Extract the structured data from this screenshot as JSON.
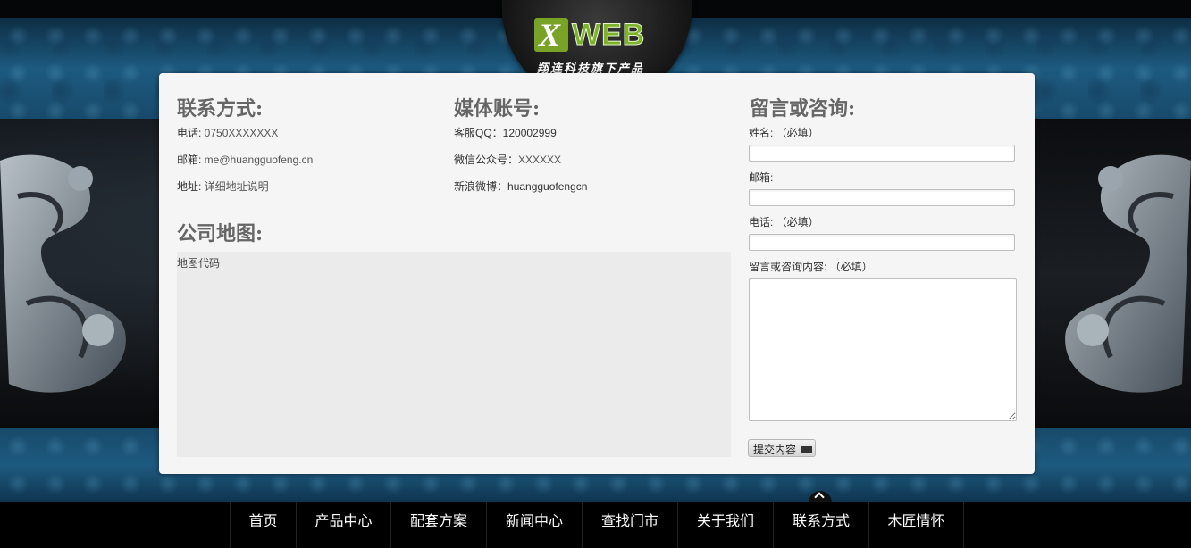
{
  "logo": {
    "mark": "X",
    "text": "WEB",
    "tagline": "翔连科技旗下产品"
  },
  "contact": {
    "title": "联系方式:",
    "items": [
      {
        "label": "电话: ",
        "value": "0750XXXXXXX"
      },
      {
        "label": "邮箱: ",
        "value": "me@huangguofeng.cn"
      },
      {
        "label": "地址: ",
        "value": "详细地址说明"
      }
    ]
  },
  "media": {
    "title": "媒体账号:",
    "items": [
      {
        "label": "客服QQ：",
        "value": "120002999"
      },
      {
        "label": "微信公众号：",
        "value": "XXXXXX"
      },
      {
        "label": "新浪微博：",
        "value": "huangguofengcn"
      }
    ]
  },
  "map": {
    "title": "公司地图:",
    "content": "地图代码"
  },
  "form": {
    "title": "留言或咨询:",
    "name_label": "姓名: （必填）",
    "email_label": "邮箱:",
    "phone_label": "电话: （必填）",
    "message_label": "留言或咨询内容: （必填）",
    "name_value": "",
    "email_value": "",
    "phone_value": "",
    "message_value": "",
    "submit_label": "提交内容",
    "submit_icon": "mail-icon"
  },
  "nav": {
    "items": [
      "首页",
      "产品中心",
      "配套方案",
      "新闻中心",
      "查找门市",
      "关于我们",
      "联系方式",
      "木匠情怀"
    ],
    "scroll_top_icon": "chevron-up-icon"
  }
}
